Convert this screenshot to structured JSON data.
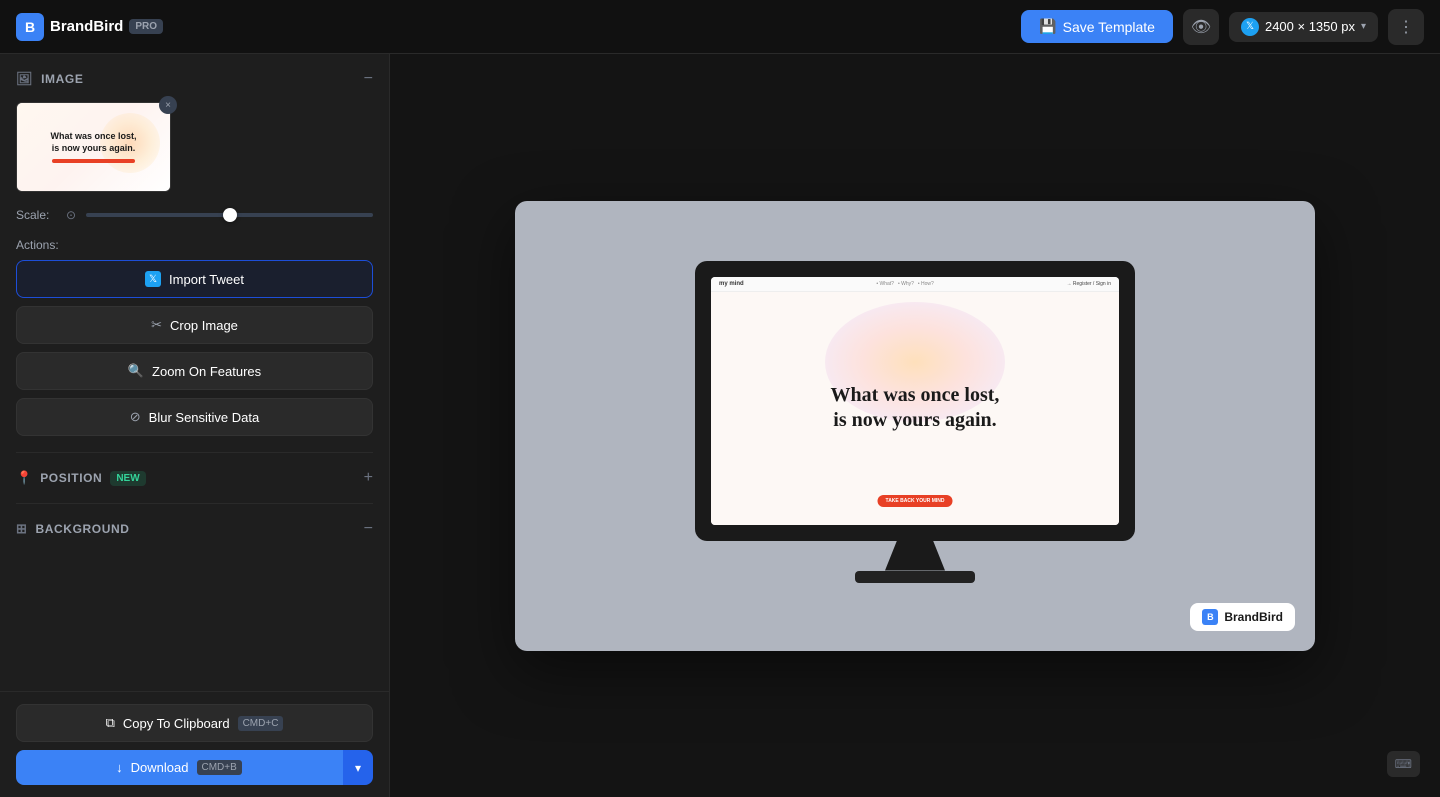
{
  "app": {
    "name": "BrandBird",
    "pro_label": "PRO"
  },
  "header": {
    "save_template_label": "Save Template",
    "dimension_label": "2400 × 1350 px"
  },
  "left_panel": {
    "image_section": {
      "title": "IMAGE",
      "preview_text_line1": "What was once lost,",
      "preview_text_line2": "is now yours again."
    },
    "scale_label": "Scale:",
    "actions_label": "Actions:",
    "import_tweet_label": "Import Tweet",
    "crop_image_label": "Crop Image",
    "zoom_on_features_label": "Zoom On Features",
    "blur_sensitive_label": "Blur Sensitive Data",
    "position_section": {
      "title": "POSITION",
      "new_badge": "NEW"
    },
    "background_section": {
      "title": "BACKGROUND"
    },
    "copy_clipboard_label": "Copy To Clipboard",
    "copy_shortcut": "CMD+C",
    "download_label": "Download",
    "download_shortcut": "CMD+B"
  },
  "canvas": {
    "screen_headline_line1": "What was once lost,",
    "screen_headline_line2": "is now yours again.",
    "nav_logo": "my mind",
    "nav_links": [
      "• What?",
      "• Why?",
      "• How?"
    ],
    "nav_cta": "→ Register / Sign in",
    "cta_btn": "TAKE BACK YOUR MIND",
    "watermark_label": "BrandBird"
  },
  "icons": {
    "save": "💾",
    "eye": "👁",
    "more": "⋮",
    "image": "🖼",
    "minus": "−",
    "twitter": "𝕏",
    "crop": "✂",
    "zoom": "🔍",
    "blur": "⊘",
    "pin": "📍",
    "plus": "+",
    "layers": "⊞",
    "copy": "⧉",
    "download": "↓",
    "chevron_down": "›",
    "close": "×",
    "apple": ""
  }
}
